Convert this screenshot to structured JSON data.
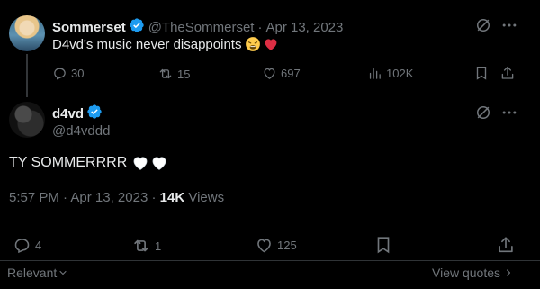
{
  "parent_tweet": {
    "display_name": "Sommerset",
    "handle": "@TheSommerset",
    "separator": "·",
    "date": "Apr 13, 2023",
    "text": "D4vd's music never disappoints",
    "emojis": [
      "weary-face-emoji",
      "red-heart-emoji"
    ],
    "stats": {
      "replies": "30",
      "retweets": "15",
      "likes": "697",
      "views": "102K"
    }
  },
  "main_tweet": {
    "display_name": "d4vd",
    "handle": "@d4vddd",
    "text": "TY SOMMERRRR",
    "emojis": [
      "white-heart-emoji",
      "white-heart-emoji"
    ],
    "time": "5:57 PM",
    "separator": "·",
    "date": "Apr 13, 2023",
    "views_count": "14K",
    "views_label": "Views",
    "stats": {
      "replies": "4",
      "retweets": "1",
      "likes": "125"
    }
  },
  "footer": {
    "sort_label": "Relevant",
    "view_quotes_label": "View quotes"
  },
  "colors": {
    "verified": "#1d9bf0",
    "heart": "#e0245e",
    "muted": "#71767b",
    "divider": "#2f3336"
  }
}
